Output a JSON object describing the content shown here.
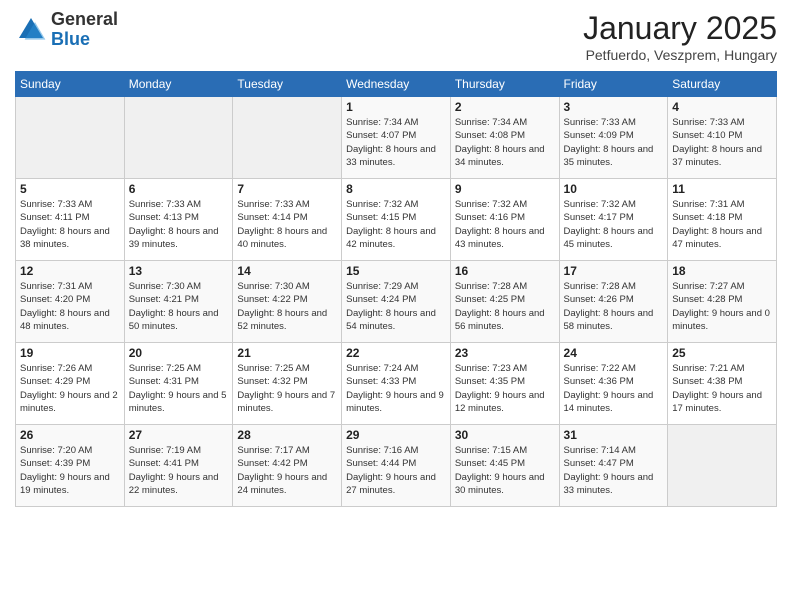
{
  "header": {
    "logo_general": "General",
    "logo_blue": "Blue",
    "month_title": "January 2025",
    "subtitle": "Petfuerdo, Veszprem, Hungary"
  },
  "weekdays": [
    "Sunday",
    "Monday",
    "Tuesday",
    "Wednesday",
    "Thursday",
    "Friday",
    "Saturday"
  ],
  "weeks": [
    [
      {
        "day": "",
        "info": ""
      },
      {
        "day": "",
        "info": ""
      },
      {
        "day": "",
        "info": ""
      },
      {
        "day": "1",
        "info": "Sunrise: 7:34 AM\nSunset: 4:07 PM\nDaylight: 8 hours\nand 33 minutes."
      },
      {
        "day": "2",
        "info": "Sunrise: 7:34 AM\nSunset: 4:08 PM\nDaylight: 8 hours\nand 34 minutes."
      },
      {
        "day": "3",
        "info": "Sunrise: 7:33 AM\nSunset: 4:09 PM\nDaylight: 8 hours\nand 35 minutes."
      },
      {
        "day": "4",
        "info": "Sunrise: 7:33 AM\nSunset: 4:10 PM\nDaylight: 8 hours\nand 37 minutes."
      }
    ],
    [
      {
        "day": "5",
        "info": "Sunrise: 7:33 AM\nSunset: 4:11 PM\nDaylight: 8 hours\nand 38 minutes."
      },
      {
        "day": "6",
        "info": "Sunrise: 7:33 AM\nSunset: 4:13 PM\nDaylight: 8 hours\nand 39 minutes."
      },
      {
        "day": "7",
        "info": "Sunrise: 7:33 AM\nSunset: 4:14 PM\nDaylight: 8 hours\nand 40 minutes."
      },
      {
        "day": "8",
        "info": "Sunrise: 7:32 AM\nSunset: 4:15 PM\nDaylight: 8 hours\nand 42 minutes."
      },
      {
        "day": "9",
        "info": "Sunrise: 7:32 AM\nSunset: 4:16 PM\nDaylight: 8 hours\nand 43 minutes."
      },
      {
        "day": "10",
        "info": "Sunrise: 7:32 AM\nSunset: 4:17 PM\nDaylight: 8 hours\nand 45 minutes."
      },
      {
        "day": "11",
        "info": "Sunrise: 7:31 AM\nSunset: 4:18 PM\nDaylight: 8 hours\nand 47 minutes."
      }
    ],
    [
      {
        "day": "12",
        "info": "Sunrise: 7:31 AM\nSunset: 4:20 PM\nDaylight: 8 hours\nand 48 minutes."
      },
      {
        "day": "13",
        "info": "Sunrise: 7:30 AM\nSunset: 4:21 PM\nDaylight: 8 hours\nand 50 minutes."
      },
      {
        "day": "14",
        "info": "Sunrise: 7:30 AM\nSunset: 4:22 PM\nDaylight: 8 hours\nand 52 minutes."
      },
      {
        "day": "15",
        "info": "Sunrise: 7:29 AM\nSunset: 4:24 PM\nDaylight: 8 hours\nand 54 minutes."
      },
      {
        "day": "16",
        "info": "Sunrise: 7:28 AM\nSunset: 4:25 PM\nDaylight: 8 hours\nand 56 minutes."
      },
      {
        "day": "17",
        "info": "Sunrise: 7:28 AM\nSunset: 4:26 PM\nDaylight: 8 hours\nand 58 minutes."
      },
      {
        "day": "18",
        "info": "Sunrise: 7:27 AM\nSunset: 4:28 PM\nDaylight: 9 hours\nand 0 minutes."
      }
    ],
    [
      {
        "day": "19",
        "info": "Sunrise: 7:26 AM\nSunset: 4:29 PM\nDaylight: 9 hours\nand 2 minutes."
      },
      {
        "day": "20",
        "info": "Sunrise: 7:25 AM\nSunset: 4:31 PM\nDaylight: 9 hours\nand 5 minutes."
      },
      {
        "day": "21",
        "info": "Sunrise: 7:25 AM\nSunset: 4:32 PM\nDaylight: 9 hours\nand 7 minutes."
      },
      {
        "day": "22",
        "info": "Sunrise: 7:24 AM\nSunset: 4:33 PM\nDaylight: 9 hours\nand 9 minutes."
      },
      {
        "day": "23",
        "info": "Sunrise: 7:23 AM\nSunset: 4:35 PM\nDaylight: 9 hours\nand 12 minutes."
      },
      {
        "day": "24",
        "info": "Sunrise: 7:22 AM\nSunset: 4:36 PM\nDaylight: 9 hours\nand 14 minutes."
      },
      {
        "day": "25",
        "info": "Sunrise: 7:21 AM\nSunset: 4:38 PM\nDaylight: 9 hours\nand 17 minutes."
      }
    ],
    [
      {
        "day": "26",
        "info": "Sunrise: 7:20 AM\nSunset: 4:39 PM\nDaylight: 9 hours\nand 19 minutes."
      },
      {
        "day": "27",
        "info": "Sunrise: 7:19 AM\nSunset: 4:41 PM\nDaylight: 9 hours\nand 22 minutes."
      },
      {
        "day": "28",
        "info": "Sunrise: 7:17 AM\nSunset: 4:42 PM\nDaylight: 9 hours\nand 24 minutes."
      },
      {
        "day": "29",
        "info": "Sunrise: 7:16 AM\nSunset: 4:44 PM\nDaylight: 9 hours\nand 27 minutes."
      },
      {
        "day": "30",
        "info": "Sunrise: 7:15 AM\nSunset: 4:45 PM\nDaylight: 9 hours\nand 30 minutes."
      },
      {
        "day": "31",
        "info": "Sunrise: 7:14 AM\nSunset: 4:47 PM\nDaylight: 9 hours\nand 33 minutes."
      },
      {
        "day": "",
        "info": ""
      }
    ]
  ]
}
